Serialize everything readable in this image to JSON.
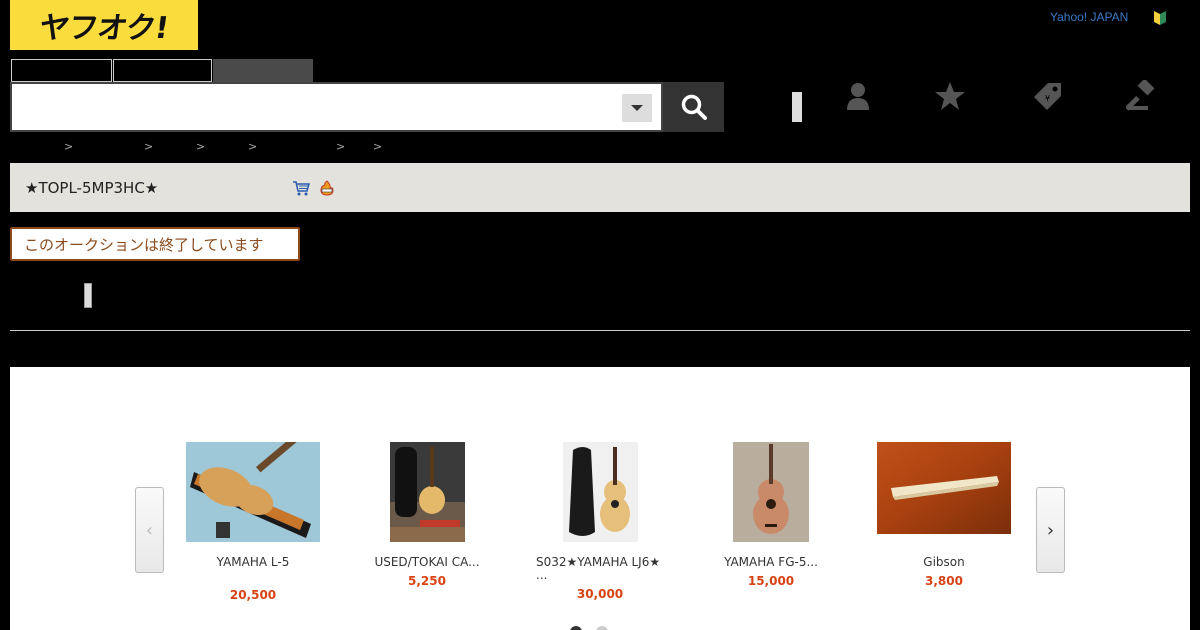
{
  "header": {
    "logo_text": "ヤフオク!",
    "yahoo_link": "Yahoo! JAPAN",
    "beginner_icon": "beginner-mark-icon"
  },
  "search": {
    "value": "",
    "placeholder": "",
    "dropdown_icon": "chevron-down-icon",
    "button_icon": "search-icon"
  },
  "nav_icons": [
    "user-icon",
    "star-icon",
    "tag-icon",
    "gavel-icon"
  ],
  "breadcrumb": {
    "separator": ">"
  },
  "item": {
    "title": "★TOPL-5MP3HC★",
    "icons": [
      "cart-icon",
      "fire-icon"
    ],
    "status": "このオークションは終了しています"
  },
  "recommendations": {
    "items": [
      {
        "name": "YAMAHA L-5",
        "price": "20,500"
      },
      {
        "name": "USED/TOKAI CA...",
        "price": "5,250"
      },
      {
        "name": "S032★YAMAHA LJ6★",
        "name2": "...",
        "price": "30,000"
      },
      {
        "name": "YAMAHA FG-5...",
        "price": "15,000"
      },
      {
        "name": "Gibson",
        "price": "3,800"
      }
    ],
    "prev_icon": "chevron-left-icon",
    "next_icon": "chevron-right-icon"
  },
  "colors": {
    "brand_yellow": "#fadd3c",
    "price_red": "#d84315",
    "status_brown": "#8a4a1c"
  }
}
